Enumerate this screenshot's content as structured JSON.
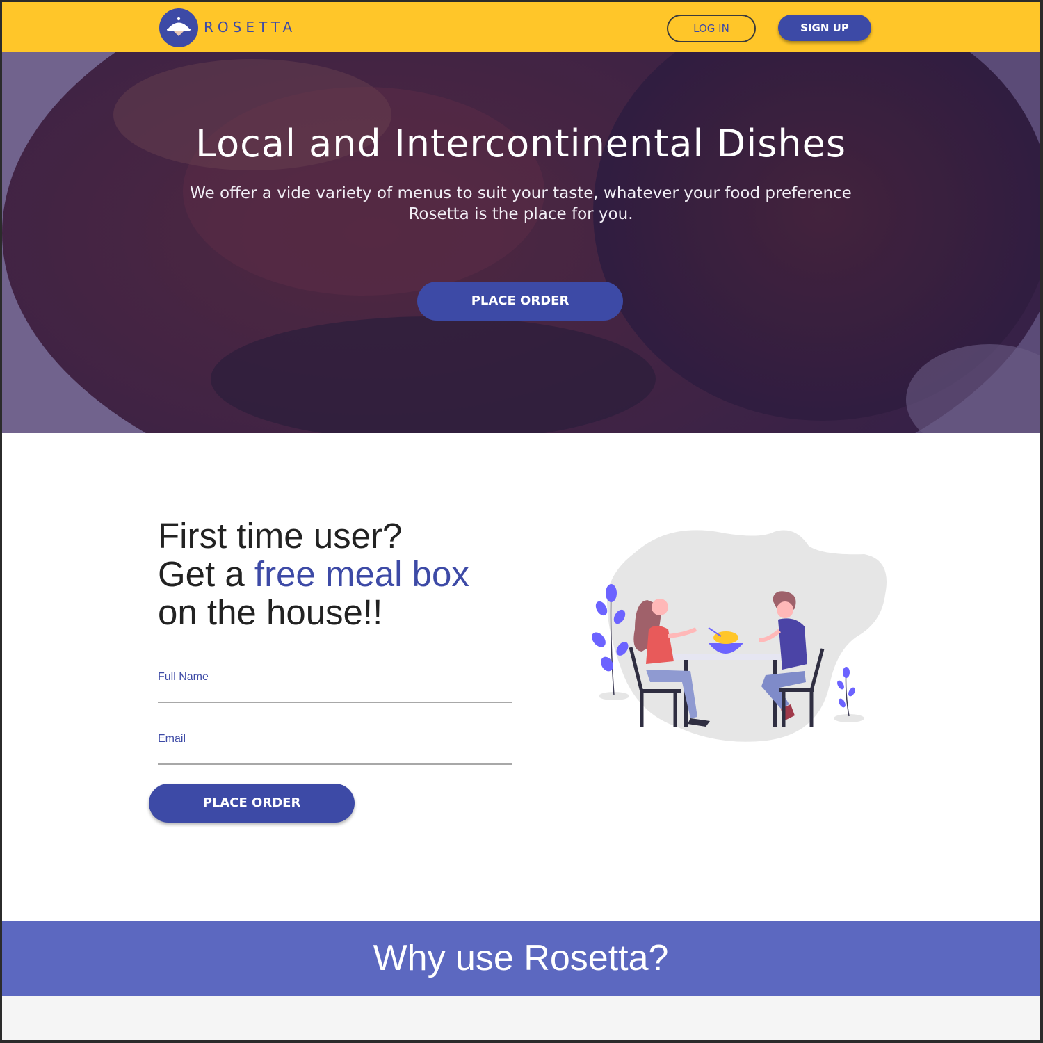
{
  "header": {
    "brand": "ROSETTA",
    "login_label": "LOG IN",
    "signup_label": "SIGN UP"
  },
  "hero": {
    "title": "Local and Intercontinental Dishes",
    "subtitle": "We offer a vide variety of menus to suit your taste, whatever your food preference Rosetta is the place for you.",
    "cta_label": "PLACE ORDER"
  },
  "signup": {
    "title_line1": "First time user?",
    "title_line2_prefix": "Get a ",
    "title_line2_accent": "free meal box",
    "title_line3": "on the house!!",
    "full_name_label": "Full Name",
    "full_name_value": "",
    "email_label": "Email",
    "email_value": "",
    "submit_label": "PLACE ORDER"
  },
  "why": {
    "title": "Why use Rosetta?"
  },
  "colors": {
    "header_bg": "#ffc629",
    "primary": "#3d4aa6",
    "why_band": "#5c68c0",
    "hero_overlay": "#3a2548"
  },
  "icons": {
    "logo": "chef-hat-logo-icon",
    "illustration": "couple-dining-illustration"
  }
}
